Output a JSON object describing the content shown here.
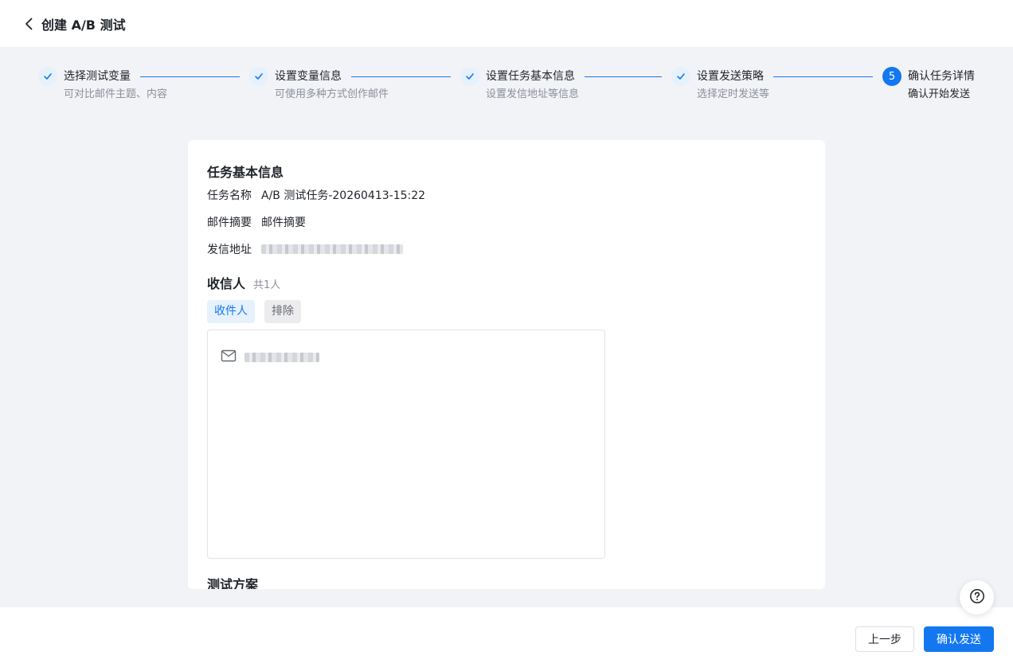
{
  "header": {
    "title": "创建 A/B 测试"
  },
  "steps": [
    {
      "title": "选择测试变量",
      "desc": "可对比邮件主题、内容",
      "status": "done"
    },
    {
      "title": "设置变量信息",
      "desc": "可使用多种方式创作邮件",
      "status": "done"
    },
    {
      "title": "设置任务基本信息",
      "desc": "设置发信地址等信息",
      "status": "done"
    },
    {
      "title": "设置发送策略",
      "desc": "选择定时发送等",
      "status": "done"
    },
    {
      "title": "确认任务详情",
      "desc": "确认开始发送",
      "status": "active",
      "number": "5"
    }
  ],
  "card": {
    "basic_title": "任务基本信息",
    "fields": [
      {
        "label": "任务名称",
        "value": "A/B 测试任务-20260413-15:22"
      },
      {
        "label": "邮件摘要",
        "value": "邮件摘要"
      },
      {
        "label": "发信地址",
        "value": ""
      }
    ],
    "recipients_title": "收信人",
    "recipients_count": "共1人",
    "tabs": {
      "include": "收件人",
      "exclude": "排除"
    },
    "plan_title": "测试方案"
  },
  "footer": {
    "prev_label": "上一步",
    "confirm_label": "确认发送"
  },
  "colors": {
    "primary": "#1377f0",
    "background": "#f2f3f6"
  }
}
